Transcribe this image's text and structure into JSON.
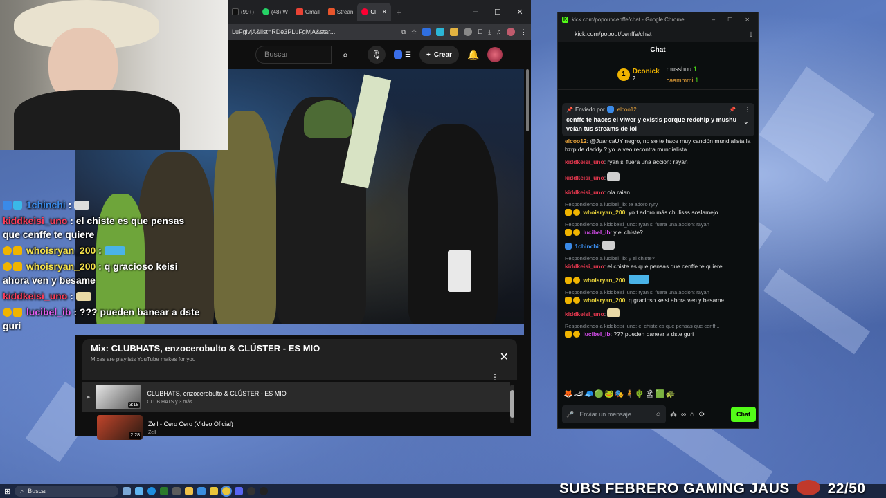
{
  "colors": {
    "kick_green": "#53fc18",
    "yt_dark": "#0f0f0f",
    "gold": "#f0b400"
  },
  "youtube": {
    "tabs": [
      {
        "label": "(99+) ",
        "icon": "tiktok-icon"
      },
      {
        "label": "(48) W",
        "icon": "whatsapp-icon"
      },
      {
        "label": "Gmail",
        "icon": "gmail-icon"
      },
      {
        "label": "Strean",
        "icon": "streamlabs-icon"
      },
      {
        "label": "Cl",
        "icon": "youtube-icon"
      }
    ],
    "url": "LuFglvjA&list=RDe3PLuFglvjA&star...",
    "search_placeholder": "Buscar",
    "create_label": "Crear",
    "playlist": {
      "title": "Mix: CLUBHATS, enzocerobulto & CLÚSTER - ES MIO",
      "subtitle": "Mixes are playlists YouTube makes for you",
      "items": [
        {
          "title": "CLUBHATS, enzocerobulto & CLÚSTER - ES MIO",
          "artist": "CLUB HATS y 3 más",
          "duration": "3:18"
        },
        {
          "title": "Zell - Cero Cero (Video Oficial)",
          "artist": "Zell",
          "duration": "2:28"
        }
      ]
    }
  },
  "overlay": {
    "lines": [
      {
        "user": "1chinchi",
        "text": ":"
      },
      {
        "user": "kiddkeisi_uno",
        "text": ": el chiste es que pensas que cenffe te quiere"
      },
      {
        "user": "whoisryan_200",
        "text": ":"
      },
      {
        "user": "whoisryan_200",
        "text": ": q gracioso keisi ahora ven y besame"
      },
      {
        "user": "kiddkeisi_uno",
        "text": ":"
      },
      {
        "user": "lucibel_ib",
        "text": ": ??? pueden banear a dste guri"
      }
    ]
  },
  "kick": {
    "window_title": "kick.com/popout/cenffe/chat - Google Chrome",
    "url": "kick.com/popout/cenffe/chat",
    "header": "Chat",
    "top_gifters": [
      {
        "rank": "1",
        "name": "Dconick",
        "count": "2"
      },
      {
        "rank": "",
        "name": "musshuu",
        "count": "1"
      },
      {
        "rank": "",
        "name": "caammmi",
        "count": "1"
      }
    ],
    "pinned": {
      "label": "Enviado por",
      "user": "elcoo12",
      "text": "cenffe te haces el viwer y existis porque redchip y mushu veían tus streams de lol"
    },
    "messages": [
      {
        "reply": "",
        "user": "elcoo12",
        "text": ": @JuancaUY negro, no se te hace muy canción mundialista la bzrp de daddy ? yo la veo recontra mundialista",
        "color": "#e8a33a"
      },
      {
        "reply": "",
        "user": "kiddkeisi_uno",
        "text": ": ryan si fuera una accion: rayan",
        "color": "#e8384f"
      },
      {
        "reply": "",
        "user": "kiddkeisi_uno",
        "text": ":",
        "color": "#e8384f"
      },
      {
        "reply": "",
        "user": "kiddkeisi_uno",
        "text": ": ola raian",
        "color": "#e8384f"
      },
      {
        "reply": "Respondiendo a lucibel_ib: te adoro ryry",
        "user": "whoisryan_200",
        "text": ": yo t adoro más chulisss soslamejo",
        "color": "#e8d23a"
      },
      {
        "reply": "Respondiendo a kiddkeisi_uno: ryan si fuera una accion: rayan",
        "user": "lucibel_ib",
        "text": ": y el chiste?",
        "color": "#d24be8"
      },
      {
        "reply": "",
        "user": "1chinchi",
        "text": ":",
        "color": "#3a8ae8"
      },
      {
        "reply": "Respondiendo a lucibel_ib: y el chiste?",
        "user": "kiddkeisi_uno",
        "text": ": el chiste es que pensas que cenffe te quiere",
        "color": "#e8384f"
      },
      {
        "reply": "",
        "user": "whoisryan_200",
        "text": ":",
        "color": "#e8d23a"
      },
      {
        "reply": "Respondiendo a kiddkeisi_uno: ryan si fuera una accion: rayan",
        "user": "whoisryan_200",
        "text": ": q gracioso keisi ahora ven y besame",
        "color": "#e8d23a"
      },
      {
        "reply": "",
        "user": "kiddkeisi_uno",
        "text": ":",
        "color": "#e8384f"
      },
      {
        "reply": "Respondiendo a kiddkeisi_uno: el chiste es que pensas que cenff...",
        "user": "lucibel_ib",
        "text": ": ??? pueden banear a dste guri",
        "color": "#d24be8"
      }
    ],
    "input_placeholder": "Enviar un mensaje",
    "chat_button": "Chat"
  },
  "taskbar": {
    "search": "Buscar"
  },
  "subs_banner": "SUBS FEBRERO GAMING JAUS",
  "subs_count": "22/50"
}
